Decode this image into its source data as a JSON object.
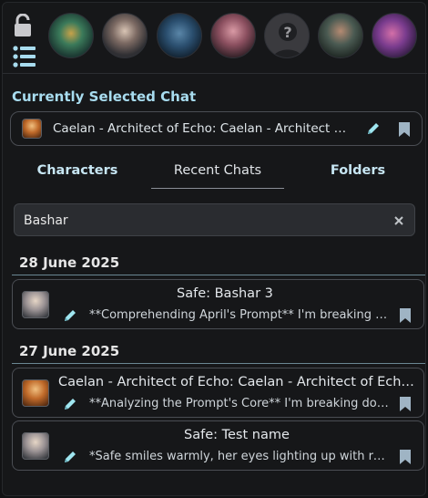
{
  "top_bar": {
    "avatars": [
      {
        "name": "avatar-1",
        "color": "#3b7a5a"
      },
      {
        "name": "avatar-2",
        "color": "#7c6a63"
      },
      {
        "name": "avatar-3",
        "color": "#2b4f6f"
      },
      {
        "name": "avatar-4",
        "color": "#8c5060"
      },
      {
        "name": "avatar-5-unknown",
        "color": "#3a3a3e",
        "icon": "question-mark-icon"
      },
      {
        "name": "avatar-6",
        "color": "#4a5a52"
      },
      {
        "name": "avatar-7",
        "color": "#7a3c8e"
      }
    ],
    "icons": [
      "lock-open-icon",
      "list-menu-icon"
    ]
  },
  "current_chat": {
    "heading": "Currently Selected Chat",
    "title": "Caelan - Architect of Echo: Caelan - Architect of Echo",
    "icons": [
      "edit-pencil-icon",
      "bookmark-icon"
    ]
  },
  "tabs": [
    {
      "label": "Characters",
      "active": false
    },
    {
      "label": "Recent Chats",
      "active": true
    },
    {
      "label": "Folders",
      "active": false
    }
  ],
  "search": {
    "value": "Bashar",
    "clear_icon": "clear-x-icon"
  },
  "groups": [
    {
      "date": "28 June 2025",
      "chats": [
        {
          "title": "Safe: Bashar 3",
          "preview": "**Comprehending April's Prompt** I'm breaking down the user's request",
          "thumb_color": "#9a9294"
        }
      ]
    },
    {
      "date": "27 June 2025",
      "chats": [
        {
          "title": "Caelan - Architect of Echo: Caelan - Architect of Echo - Branch",
          "preview": "**Analyzing the Prompt's Core** I'm breaking down the user's prompt",
          "thumb_color": "#c06a2a"
        },
        {
          "title": "Safe: Test name",
          "preview": "*Safe smiles warmly, her eyes lighting up with recognition as she",
          "thumb_color": "#9a9294"
        }
      ]
    }
  ],
  "colors": {
    "accent": "#a8dcef",
    "icon": "#9fe6f0",
    "background": "#161719",
    "border": "#4a4d53"
  }
}
